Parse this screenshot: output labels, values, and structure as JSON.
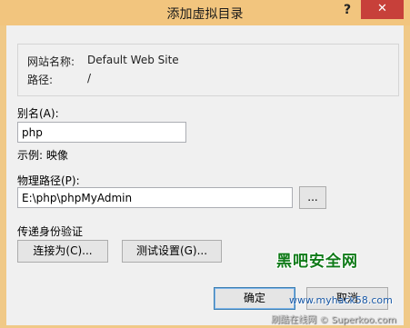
{
  "window": {
    "title": "添加虚拟目录",
    "help_glyph": "?",
    "close_glyph": "✕",
    "close_color": "#c7403a"
  },
  "site_info": {
    "site_name_label": "网站名称:",
    "site_name_value": "Default Web Site",
    "path_label": "路径:",
    "path_value": "/"
  },
  "alias": {
    "label": "别名(A):",
    "value": "php",
    "example": "示例: 映像"
  },
  "physical_path": {
    "label": "物理路径(P):",
    "value": "E:\\php\\phpMyAdmin",
    "browse_label": "..."
  },
  "auth": {
    "section_label": "传递身份验证",
    "connect_as_label": "连接为(C)...",
    "test_settings_label": "测试设置(G)..."
  },
  "footer": {
    "ok_label": "确定",
    "cancel_label": "取消"
  },
  "watermark": {
    "logo_text": "黑吧安全网",
    "url_text": "www.myhack58.com",
    "footer_text": "刷酷在线网 © Superkoo.com"
  }
}
